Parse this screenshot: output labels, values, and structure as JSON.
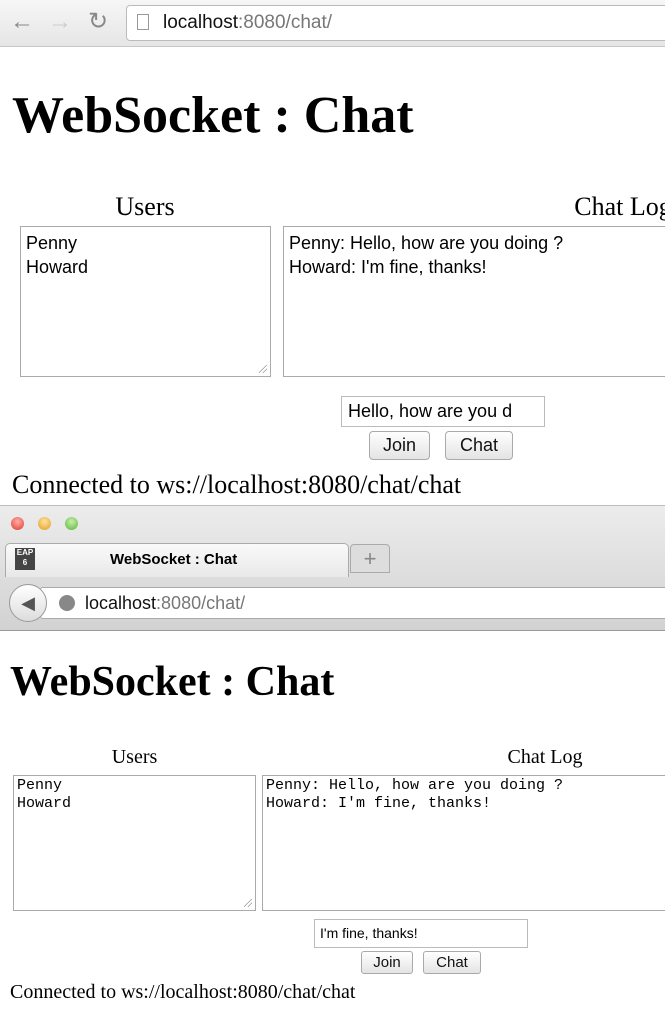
{
  "top": {
    "url_host": "localhost",
    "url_rest": ":8080/chat/",
    "title": "WebSocket : Chat",
    "users_label": "Users",
    "chatlog_label": "Chat Log",
    "users": "Penny\nHoward",
    "chatlog": "Penny: Hello, how are you doing ?\nHoward: I'm fine, thanks!",
    "message_value": "Hello, how are you d",
    "join_label": "Join",
    "chat_label": "Chat",
    "status": "Connected to ws://localhost:8080/chat/chat"
  },
  "bottom": {
    "tab_title": "WebSocket : Chat",
    "tab_icon": "EAP 6",
    "new_tab": "+",
    "url_host": "localhost",
    "url_rest": ":8080/chat/",
    "title": "WebSocket : Chat",
    "users_label": "Users",
    "chatlog_label": "Chat Log",
    "users": "Penny\nHoward",
    "chatlog": "Penny: Hello, how are you doing ?\nHoward: I'm fine, thanks!",
    "message_value": "I'm fine, thanks!",
    "join_label": "Join",
    "chat_label": "Chat",
    "status": "Connected to ws://localhost:8080/chat/chat"
  }
}
